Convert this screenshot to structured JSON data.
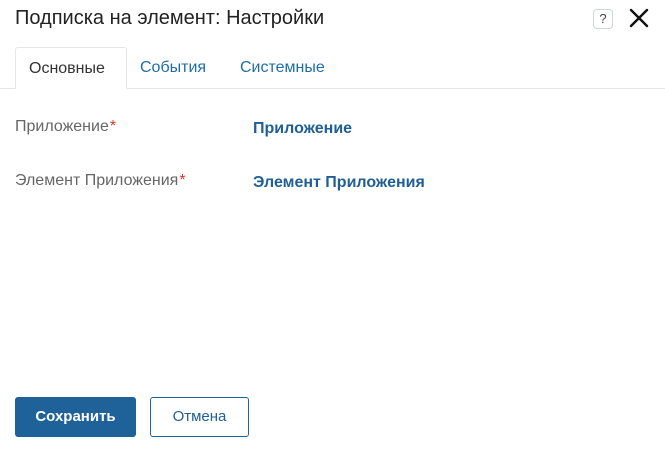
{
  "dialog": {
    "title": "Подписка на элемент: Настройки",
    "help_label": "?",
    "tabs": [
      {
        "label": "Основные",
        "active": true
      },
      {
        "label": "События",
        "active": false
      },
      {
        "label": "Системные",
        "active": false
      }
    ],
    "fields": [
      {
        "label": "Приложение",
        "required_mark": "*",
        "value": "Приложение"
      },
      {
        "label": "Элемент Приложения",
        "required_mark": "*",
        "value": "Элемент Приложения"
      }
    ],
    "buttons": {
      "save_label": "Сохранить",
      "cancel_label": "Отмена"
    }
  },
  "colors": {
    "accent": "#1f6199",
    "link": "#1f5f95",
    "required": "#d9342b"
  }
}
